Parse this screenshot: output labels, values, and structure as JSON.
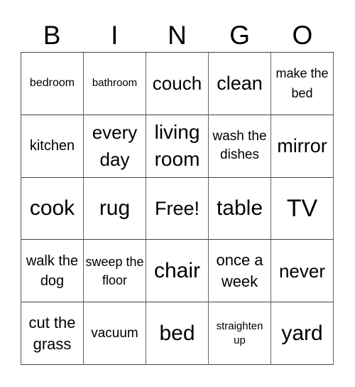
{
  "header": {
    "letters": [
      "B",
      "I",
      "N",
      "G",
      "O"
    ]
  },
  "cells": [
    {
      "text": "bedroom"
    },
    {
      "text": "bathroom"
    },
    {
      "text": "couch"
    },
    {
      "text": "clean"
    },
    {
      "text": "make the bed"
    },
    {
      "text": "kitchen"
    },
    {
      "text": "every day"
    },
    {
      "text": "living room"
    },
    {
      "text": "wash the dishes"
    },
    {
      "text": "mirror"
    },
    {
      "text": "cook"
    },
    {
      "text": "rug"
    },
    {
      "text": "Free!"
    },
    {
      "text": "table"
    },
    {
      "text": "TV"
    },
    {
      "text": "walk the dog"
    },
    {
      "text": "sweep the floor"
    },
    {
      "text": "chair"
    },
    {
      "text": "once a week"
    },
    {
      "text": "never"
    },
    {
      "text": "cut the grass"
    },
    {
      "text": "vacuum"
    },
    {
      "text": "bed"
    },
    {
      "text": "straighten up"
    },
    {
      "text": "yard"
    }
  ]
}
